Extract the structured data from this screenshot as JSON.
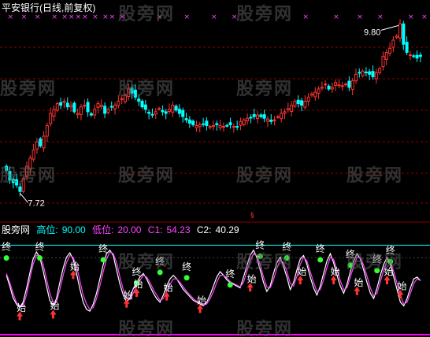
{
  "title": "平安银行(日线,前复权)",
  "watermark": "股旁网",
  "colors": {
    "up": "#ff3333",
    "down": "#00ffff",
    "neutral": "#ffffff",
    "grid": "#8b0000",
    "marker": "#ff44ff",
    "indicator_line": "#ffffff",
    "indicator_line2": "#ff44ff",
    "hi_line": "#00ffff",
    "lo_line": "#ff00ff",
    "start_arrow": "#ff3333",
    "end_dot": "#33ff33"
  },
  "indicator": {
    "name": "股旁网",
    "high_label": "高位:",
    "high_value": "90.00",
    "low_label": "低位:",
    "low_value": "20.00",
    "c1_label": "C1:",
    "c1_value": "54.23",
    "c2_label": "C2:",
    "c2_value": "40.29",
    "start_char": "始",
    "end_char": "终"
  },
  "chart_data": [
    {
      "type": "candlestick",
      "title": "平安银行(日线,前复权)",
      "ylim": [
        7.5,
        9.9
      ],
      "annotations": [
        {
          "text": "9.80",
          "value": 9.8,
          "kind": "max"
        },
        {
          "text": "7.72",
          "value": 7.72,
          "kind": "min"
        }
      ],
      "closes": [
        8.0,
        7.88,
        7.85,
        7.82,
        7.74,
        7.9,
        8.05,
        8.15,
        8.25,
        8.35,
        8.3,
        8.42,
        8.55,
        8.7,
        8.75,
        8.82,
        8.8,
        8.85,
        8.78,
        8.8,
        8.72,
        8.7,
        8.78,
        8.8,
        8.72,
        8.68,
        8.75,
        8.82,
        8.8,
        8.7,
        8.75,
        8.78,
        8.8,
        8.85,
        8.88,
        8.92,
        9.0,
        8.95,
        8.9,
        8.85,
        8.78,
        8.75,
        8.7,
        8.68,
        8.72,
        8.76,
        8.72,
        8.7,
        8.75,
        8.8,
        8.74,
        8.7,
        8.66,
        8.62,
        8.58,
        8.56,
        8.55,
        8.56,
        8.57,
        8.55,
        8.54,
        8.55,
        8.56,
        8.55,
        8.54,
        8.55,
        8.56,
        8.54,
        8.53,
        8.6,
        8.62,
        8.64,
        8.65,
        8.66,
        8.68,
        8.66,
        8.64,
        8.63,
        8.6,
        8.62,
        8.66,
        8.7,
        8.72,
        8.76,
        8.8,
        8.85,
        8.82,
        8.8,
        8.85,
        8.9,
        8.94,
        8.96,
        9.0,
        9.02,
        9.06,
        9.0,
        9.02,
        9.08,
        9.05,
        9.04,
        9.06,
        9.02,
        9.1,
        9.18,
        9.2,
        9.22,
        9.2,
        9.18,
        9.15,
        9.2,
        9.25,
        9.4,
        9.45,
        9.5,
        9.6,
        9.65,
        9.8,
        9.55,
        9.45,
        9.42,
        9.4,
        9.38,
        9.4
      ],
      "highs_offset": 0.06,
      "lows_offset": 0.06,
      "marker_row": [
        1,
        5,
        9,
        14,
        17,
        19,
        21,
        23,
        26,
        29,
        31,
        34,
        45,
        53,
        61,
        67,
        88,
        97,
        104,
        110,
        119,
        123
      ]
    },
    {
      "type": "line",
      "name": "股旁网",
      "ylim": [
        0,
        100
      ],
      "hi": 90,
      "lo": 20,
      "series": [
        {
          "name": "C1",
          "values": [
            60,
            48,
            35,
            28,
            24,
            30,
            45,
            62,
            78,
            86,
            80,
            65,
            48,
            32,
            26,
            34,
            52,
            68,
            80,
            85,
            78,
            62,
            45,
            30,
            22,
            20,
            28,
            40,
            56,
            72,
            84,
            88,
            82,
            66,
            50,
            38,
            30,
            35,
            45,
            52,
            58,
            62,
            56,
            48,
            40,
            34,
            30,
            38,
            48,
            56,
            60,
            56,
            50,
            44,
            40,
            36,
            32,
            30,
            28,
            26,
            30,
            38,
            48,
            58,
            64,
            60,
            55,
            52,
            50,
            48,
            46,
            58,
            70,
            82,
            88,
            80,
            66,
            52,
            42,
            48,
            62,
            74,
            80,
            70,
            58,
            44,
            52,
            66,
            78,
            82,
            72,
            58,
            46,
            38,
            48,
            62,
            76,
            84,
            74,
            60,
            48,
            40,
            50,
            64,
            76,
            84,
            78,
            66,
            52,
            40,
            34,
            46,
            60,
            72,
            80,
            72,
            58,
            44,
            30,
            26,
            34,
            46,
            56,
            58,
            54
          ]
        },
        {
          "name": "C2",
          "values": [
            62,
            52,
            40,
            30,
            26,
            26,
            38,
            56,
            72,
            82,
            82,
            72,
            56,
            40,
            30,
            30,
            44,
            60,
            74,
            82,
            80,
            70,
            54,
            38,
            28,
            22,
            24,
            34,
            48,
            64,
            78,
            86,
            84,
            74,
            58,
            44,
            34,
            33,
            40,
            48,
            54,
            60,
            58,
            52,
            44,
            38,
            32,
            34,
            42,
            50,
            56,
            56,
            52,
            47,
            42,
            38,
            34,
            31,
            29,
            27,
            28,
            34,
            42,
            52,
            60,
            60,
            57,
            53,
            51,
            49,
            47,
            52,
            64,
            76,
            84,
            82,
            72,
            58,
            47,
            46,
            55,
            68,
            77,
            74,
            64,
            51,
            48,
            59,
            72,
            80,
            76,
            64,
            52,
            42,
            44,
            55,
            69,
            80,
            78,
            66,
            54,
            44,
            46,
            58,
            70,
            80,
            80,
            71,
            59,
            46,
            37,
            40,
            53,
            66,
            76,
            76,
            64,
            51,
            37,
            28,
            30,
            40,
            51,
            56,
            54
          ]
        }
      ],
      "events": [
        {
          "label": "终",
          "index": 0,
          "value": 88
        },
        {
          "label": "始",
          "index": 4,
          "value": 16
        },
        {
          "label": "终",
          "index": 10,
          "value": 88
        },
        {
          "label": "始",
          "index": 14,
          "value": 18
        },
        {
          "label": "始",
          "index": 20,
          "value": 62
        },
        {
          "label": "终",
          "index": 29,
          "value": 86
        },
        {
          "label": "始",
          "index": 36,
          "value": 30
        },
        {
          "label": "终",
          "index": 39,
          "value": 60
        },
        {
          "label": "始",
          "index": 39,
          "value": 42
        },
        {
          "label": "终",
          "index": 46,
          "value": 72
        },
        {
          "label": "始",
          "index": 48,
          "value": 38
        },
        {
          "label": "终",
          "index": 54,
          "value": 66
        },
        {
          "label": "始",
          "index": 58,
          "value": 24
        },
        {
          "label": "终",
          "index": 67,
          "value": 58
        },
        {
          "label": "始",
          "index": 73,
          "value": 48
        },
        {
          "label": "终",
          "index": 76,
          "value": 90
        },
        {
          "label": "终",
          "index": 84,
          "value": 88
        },
        {
          "label": "始",
          "index": 88,
          "value": 56
        },
        {
          "label": "终",
          "index": 94,
          "value": 86
        },
        {
          "label": "始",
          "index": 98,
          "value": 56
        },
        {
          "label": "终",
          "index": 103,
          "value": 80
        },
        {
          "label": "始",
          "index": 105,
          "value": 44
        },
        {
          "label": "终",
          "index": 111,
          "value": 74
        },
        {
          "label": "始",
          "index": 114,
          "value": 56
        },
        {
          "label": "终",
          "index": 115,
          "value": 84
        },
        {
          "label": "始",
          "index": 118,
          "value": 40
        }
      ]
    }
  ]
}
